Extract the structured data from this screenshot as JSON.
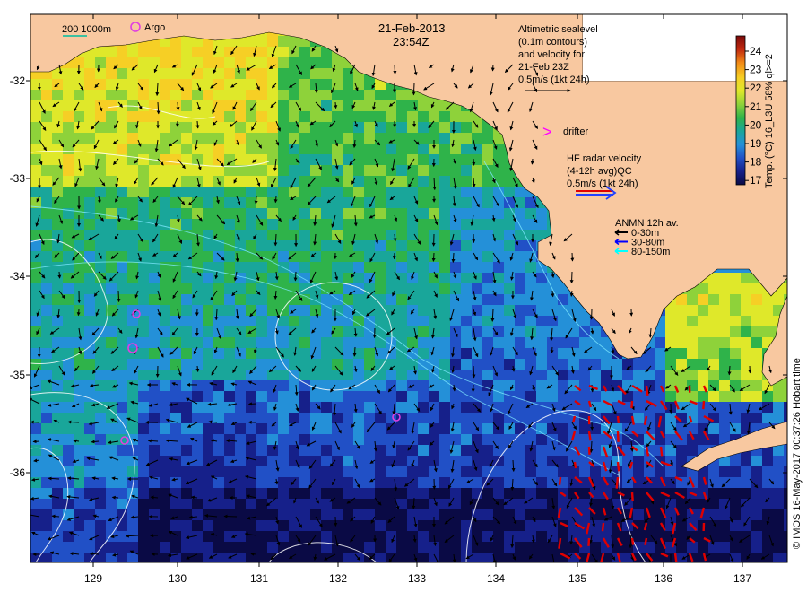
{
  "header": {
    "date": "21-Feb-2013",
    "time": "23:54Z"
  },
  "map_legend": {
    "isobath": "200  1000m",
    "argo": "Argo"
  },
  "altimetry": {
    "line1": "Altimetric sealevel",
    "line2": "(0.1m contours)",
    "line3": "and velocity for",
    "line4": "21-Feb 23Z",
    "scale": "0.5m/s (1kt 24h)"
  },
  "drifter": {
    "glyph": ">",
    "label": "drifter",
    "color": "#ff00ff"
  },
  "hf_radar": {
    "line1": "HF radar velocity",
    "line2": "(4-12h avg)QC",
    "scale": "0.5m/s (1kt 24h)",
    "color": "#ff0000"
  },
  "anmn": {
    "title": "ANMN 12h av.",
    "items": [
      {
        "label": "0-30m",
        "color": "#000000"
      },
      {
        "label": "30-80m",
        "color": "#0000ff"
      },
      {
        "label": "80-150m",
        "color": "#00ffff"
      }
    ]
  },
  "colorbar": {
    "title": "Temp. (°C) 16_L3U 58% ql>=2",
    "ticks": [
      "24",
      "23",
      "22",
      "21",
      "20",
      "19",
      "18",
      "17"
    ],
    "colors": [
      "#7a0a0a",
      "#c1290f",
      "#f28a17",
      "#f6cf25",
      "#dfe82a",
      "#8ed23a",
      "#2fb34a",
      "#19a69a",
      "#2490d8",
      "#2150c6",
      "#16208a",
      "#0a0a45"
    ]
  },
  "axes": {
    "x_ticks": [
      "129",
      "130",
      "131",
      "132",
      "133",
      "134",
      "135",
      "136",
      "137"
    ],
    "y_ticks": [
      "-32",
      "-33",
      "-34",
      "-35",
      "-36"
    ]
  },
  "credit": "© IMOS 16-May-2017 00:37:26 Hobart time",
  "colors": {
    "land": "#f8c8a0",
    "arrow": "#000000",
    "contour": "#ffffff",
    "argo": "#e040e0"
  }
}
